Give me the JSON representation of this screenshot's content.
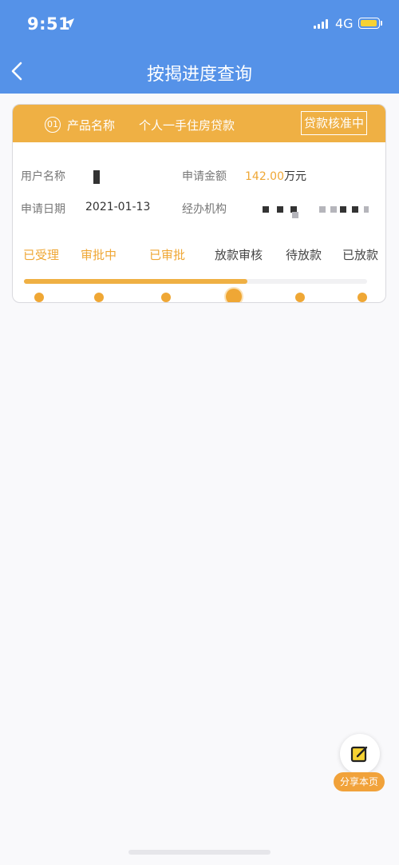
{
  "status_bar": {
    "time": "9:51",
    "network": "4G",
    "colors": {
      "battery": "#f6d233"
    }
  },
  "nav": {
    "title": "按揭进度查询",
    "back_icon": "chevron-left-icon"
  },
  "card": {
    "header": {
      "index": "01",
      "product_label": "产品名称",
      "product_name": "个人一手住房贷款",
      "status": "贷款核准中"
    },
    "fields": {
      "user_name_label": "用户名称",
      "amount_label": "申请金额",
      "amount_value": "142.00",
      "amount_unit": "万元",
      "date_label": "申请日期",
      "date_value": "2021-01-13",
      "agency_label": "经办机构"
    },
    "stages": [
      "已受理",
      "审批中",
      "已审批",
      "放款审核",
      "待放款",
      "已放款"
    ],
    "completed_stage_count": 3,
    "current_stage_index": 3,
    "progress_fraction": 0.65
  },
  "share": {
    "label": "分享本页",
    "icon": "edit-share-icon"
  },
  "colors": {
    "primary": "#5592e8",
    "accent": "#efb044",
    "accent_text": "#efa735"
  }
}
